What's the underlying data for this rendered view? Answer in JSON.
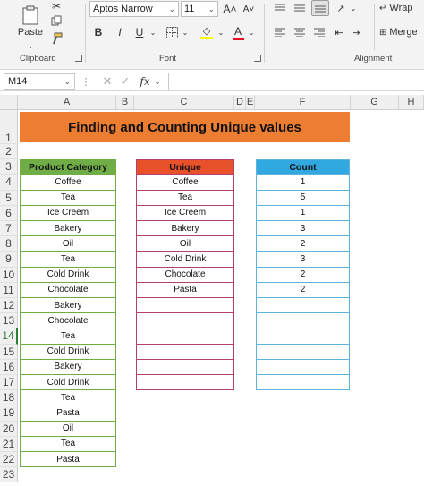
{
  "ribbon": {
    "paste_label": "Paste",
    "clipboard_label": "Clipboard",
    "font_label": "Font",
    "alignment_label": "Alignment",
    "font_name": "Aptos Narrow",
    "font_size": "11",
    "grow_font": "A˄",
    "shrink_font": "A˅",
    "bold": "B",
    "italic": "I",
    "underline": "U",
    "wrap_label": "Wrap",
    "merge_label": "Merge"
  },
  "formula_bar": {
    "name_box": "M14",
    "fx_label": "fx",
    "formula": ""
  },
  "grid": {
    "columns": [
      "A",
      "B",
      "C",
      "D",
      "E",
      "F",
      "G",
      "H"
    ],
    "rows": [
      "1",
      "2",
      "3",
      "4",
      "5",
      "6",
      "7",
      "8",
      "9",
      "10",
      "11",
      "12",
      "13",
      "14",
      "15",
      "16",
      "17",
      "18",
      "19",
      "20",
      "21",
      "22",
      "23"
    ],
    "title": "Finding and Counting Unique values",
    "product_header": "Product Category",
    "unique_header": "Unique",
    "count_header": "Count",
    "products": [
      "Coffee",
      "Tea",
      "Ice Creem",
      "Bakery",
      "Oil",
      "Tea",
      "Cold Drink",
      "Chocolate",
      "Bakery",
      "Chocolate",
      "Tea",
      "Cold Drink",
      "Bakery",
      "Cold Drink",
      "Tea",
      "Pasta",
      "Oil",
      "Tea",
      "Pasta"
    ],
    "unique": [
      "Coffee",
      "Tea",
      "Ice Creem",
      "Bakery",
      "Oil",
      "Cold Drink",
      "Chocolate",
      "Pasta",
      "",
      "",
      "",
      "",
      "",
      ""
    ],
    "counts": [
      "1",
      "5",
      "1",
      "3",
      "2",
      "3",
      "2",
      "2",
      "",
      "",
      "",
      "",
      "",
      ""
    ]
  },
  "colors": {
    "title_bg": "#ed7d31",
    "product_header_bg": "#70ad47",
    "product_border": "#70ad47",
    "unique_header_bg": "#e8512a",
    "unique_border": "#b3426a",
    "count_header_bg": "#31a8e0",
    "count_border": "#5fb4de",
    "selected_row_header": "#2f7d3e"
  }
}
